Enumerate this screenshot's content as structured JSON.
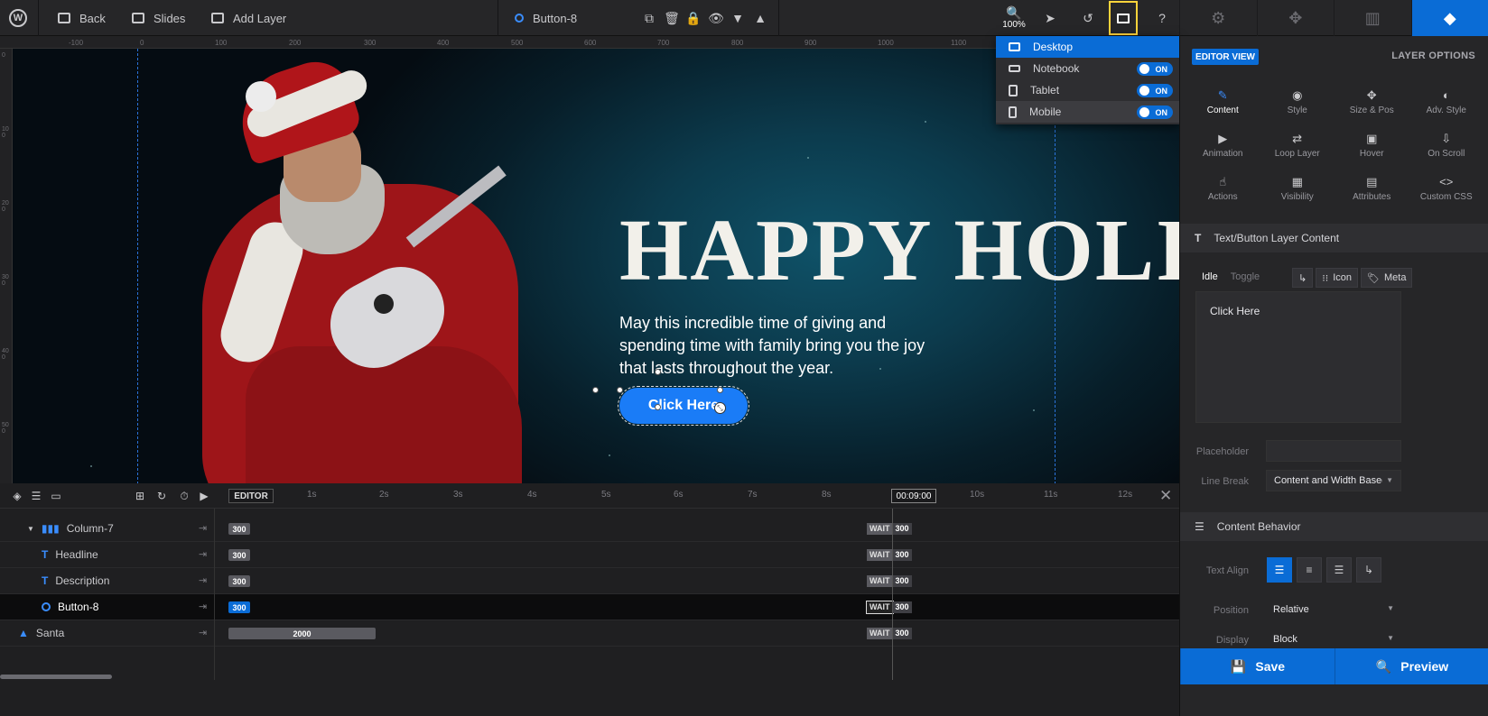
{
  "topbar": {
    "back_label": "Back",
    "slides_label": "Slides",
    "add_layer_label": "Add Layer",
    "selected_layer": "Button-8",
    "zoom": "100%"
  },
  "ruler": {
    "h_ticks": [
      "-100",
      "0",
      "100",
      "200",
      "300",
      "400",
      "500",
      "600",
      "700",
      "800",
      "900",
      "1000",
      "1100"
    ],
    "v_ticks": [
      "0",
      "100",
      "200",
      "300",
      "400",
      "500"
    ]
  },
  "canvas": {
    "headline": "HAPPY HOLID",
    "description": "May this incredible time of giving and spending time with family bring you the joy that lasts throughout the year.",
    "button": "Click Here"
  },
  "device_menu": {
    "items": [
      {
        "label": "Desktop",
        "toggle": ""
      },
      {
        "label": "Notebook",
        "toggle": "ON"
      },
      {
        "label": "Tablet",
        "toggle": "ON"
      },
      {
        "label": "Mobile",
        "toggle": "ON"
      }
    ]
  },
  "timeline": {
    "editor_tag": "EDITOR",
    "seconds": [
      "1s",
      "2s",
      "3s",
      "4s",
      "5s",
      "6s",
      "7s",
      "8s",
      "10s",
      "11s",
      "12s"
    ],
    "timecode": "00:09:00",
    "rows": [
      {
        "name": "Column-7",
        "bar": "300",
        "wait": "WAIT",
        "wait_val": "300"
      },
      {
        "name": "Headline",
        "bar": "300",
        "wait": "WAIT",
        "wait_val": "300"
      },
      {
        "name": "Description",
        "bar": "300",
        "wait": "WAIT",
        "wait_val": "300"
      },
      {
        "name": "Button-8",
        "bar": "300",
        "wait": "WAIT",
        "wait_val": "300"
      },
      {
        "name": "Santa",
        "bar": "2000",
        "wait": "WAIT",
        "wait_val": "300"
      }
    ]
  },
  "panel": {
    "editor_view": "EDITOR VIEW",
    "layer_options": "LAYER OPTIONS",
    "options": [
      "Content",
      "Style",
      "Size & Pos",
      "Adv. Style",
      "Animation",
      "Loop Layer",
      "Hover",
      "On Scroll",
      "Actions",
      "Visibility",
      "Attributes",
      "Custom CSS"
    ],
    "section1": "Text/Button Layer Content",
    "subtab_idle": "Idle",
    "subtab_toggle": "Toggle",
    "icon_label": "Icon",
    "meta_label": "Meta",
    "content_text": "Click Here",
    "placeholder_label": "Placeholder",
    "placeholder_value": "",
    "linebreak_label": "Line Break",
    "linebreak_value": "Content and Width Based",
    "section2": "Content Behavior",
    "text_align_label": "Text Align",
    "position_label": "Position",
    "position_value": "Relative",
    "display_label": "Display",
    "display_value": "Block",
    "save_label": "Save",
    "preview_label": "Preview"
  },
  "colors": {
    "accent": "#0a6cd6",
    "button": "#1a7cf7",
    "highlight": "#ffd43b"
  }
}
